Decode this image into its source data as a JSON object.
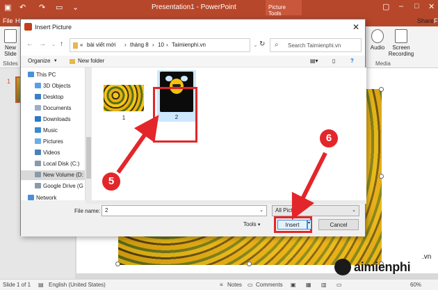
{
  "app": {
    "title": "Presentation1 - PowerPoint",
    "contextual_tab": "Picture Tools"
  },
  "ribbon_tabs": [
    "File",
    "H",
    "F"
  ],
  "ribbon": {
    "new_slide": "New Slide",
    "slides_group": "Slides",
    "audio": "Audio",
    "screen_recording": "Screen Recording",
    "media_group": "Media",
    "share": "Share"
  },
  "slide_panel": {
    "number": "1"
  },
  "dialog": {
    "title": "Insert Picture",
    "path": [
      "bài viết mới",
      "tháng 8",
      "10",
      "Taimienphi.vn"
    ],
    "search_placeholder": "Search Taimienphi.vn",
    "organize": "Organize",
    "new_folder": "New folder",
    "nav_items": [
      "This PC",
      "3D Objects",
      "Desktop",
      "Documents",
      "Downloads",
      "Music",
      "Pictures",
      "Videos",
      "Local Disk (C:)",
      "New Volume (D:",
      "Google Drive (G",
      "Network"
    ],
    "files": [
      {
        "name": "1"
      },
      {
        "name": "2"
      }
    ],
    "file_name_label": "File name:",
    "file_name_value": "2",
    "file_type": "All Pictu",
    "tools": "Tools",
    "insert": "Insert",
    "cancel": "Cancel"
  },
  "steps": {
    "step5": "5",
    "step6": "6"
  },
  "status": {
    "slide": "Slide 1 of 1",
    "language": "English (United States)",
    "notes": "Notes",
    "comments": "Comments",
    "zoom": "60%"
  },
  "watermark": {
    "name": "aimienphi",
    "suffix": ".vn"
  },
  "colors": {
    "accent": "#b7472a",
    "callout": "#e3262a"
  }
}
